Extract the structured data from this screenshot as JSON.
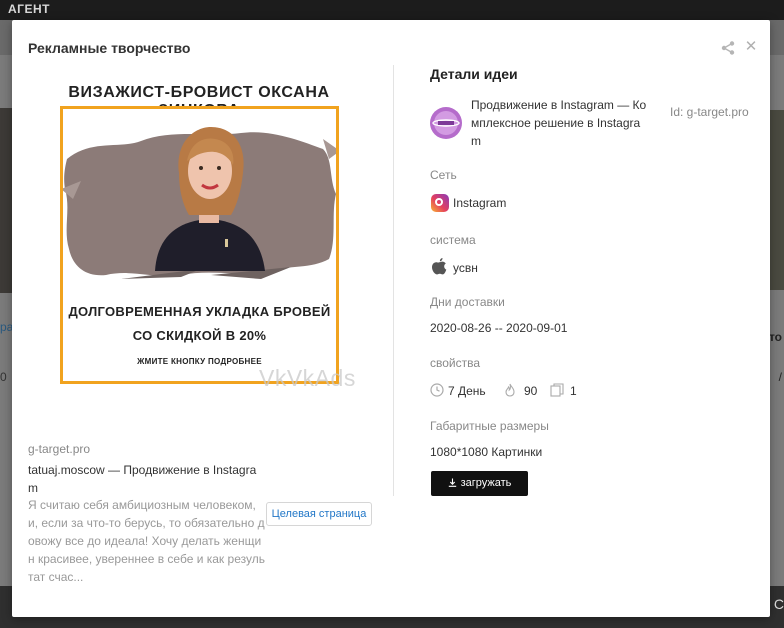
{
  "background": {
    "topbar_label": "АГЕНТ",
    "left_edge_text_1": "ра",
    "left_edge_text_2": "0",
    "right_edge_text_1": "то",
    "right_edge_text_2": "/",
    "footer_right_text": "C"
  },
  "modal": {
    "title": "Рекламные творчество",
    "icons": {
      "share": "share-icon",
      "close": "close-icon"
    },
    "close_glyph": "✕"
  },
  "creative": {
    "headline": "ВИЗАЖИСТ-БРОВИСТ ОКСАНА ЗИНКОВА",
    "offer_line_1": "ДОЛГОВРЕМЕННАЯ УКЛАДКА БРОВЕЙ",
    "offer_line_2": "СО СКИДКОЙ В 20%",
    "cta": "ЖМИТЕ КНОПКУ ПОДРОБНЕЕ",
    "watermark": "VkVkAds",
    "frame_color": "#f1a31f"
  },
  "ad": {
    "domain": "g-target.pro",
    "title": "tatuaj.moscow — Продвижение в Instagram",
    "description": "Я считаю себя амбициозным человеком, и, если за что-то берусь, то обязательно довожу все до идеала! Хочу делать женщин красивее, увереннее в себе и как результат счас...",
    "landing_button": "Целевая страница"
  },
  "details": {
    "title": "Детали идеи",
    "advertiser_name": "Продвижение в Instagram — Комплексное решение в Instagram",
    "id_label": "Id: g-target.pro",
    "network_label": "Сеть",
    "network_value": "Instagram",
    "network_icon": "instagram-icon",
    "system_label": "система",
    "system_value": "усвн",
    "system_icon": "apple-icon",
    "delivery_label": "Дни доставки",
    "delivery_value": "2020-08-26 -- 2020-09-01",
    "properties_label": "свойства",
    "days_value": "7 День",
    "heat_value": "90",
    "copies_value": "1",
    "size_label": "Габаритные размеры",
    "size_value": "1080*1080 Картинки",
    "download_button": "загружать",
    "download_icon": "download-icon"
  }
}
